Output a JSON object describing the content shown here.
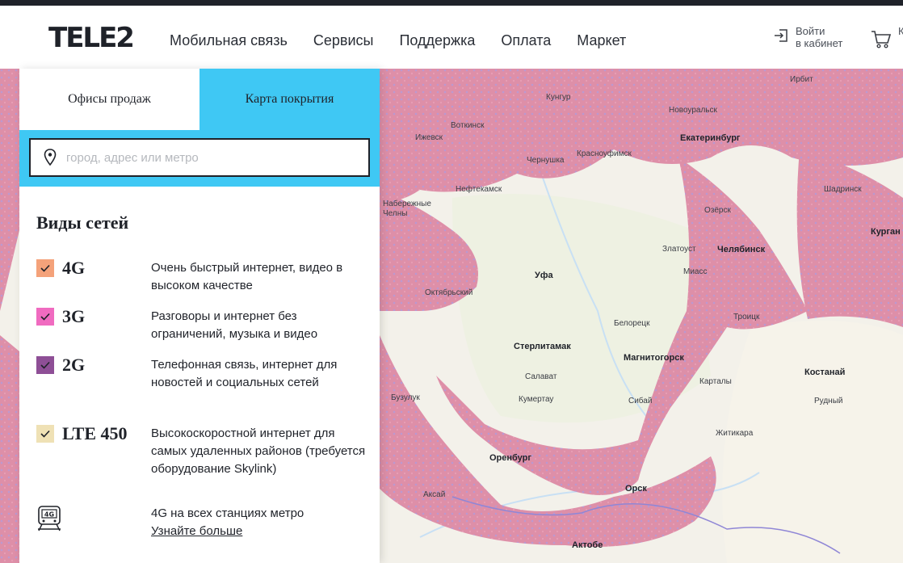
{
  "header": {
    "logo": "TELE2",
    "nav": [
      "Мобильная связь",
      "Сервисы",
      "Поддержка",
      "Оплата",
      "Маркет"
    ],
    "login": [
      "Войти",
      "в кабинет"
    ],
    "cart_label": "К"
  },
  "panel": {
    "tabs": [
      {
        "label": "Офисы продаж",
        "active": false
      },
      {
        "label": "Карта покрытия",
        "active": true
      }
    ],
    "search_placeholder": "город, адрес или метро",
    "section_title": "Виды сетей",
    "networks": [
      {
        "name": "4G",
        "color": "#f4a27a",
        "checked": true,
        "desc": "Очень быстрый интернет, видео в высоком качестве"
      },
      {
        "name": "3G",
        "color": "#f06bc0",
        "checked": true,
        "desc": "Разговоры и интернет без ограничений, музыка и видео"
      },
      {
        "name": "2G",
        "color": "#8e4f96",
        "checked": true,
        "desc": "Телефонная связь, интернет для новостей и социальных сетей"
      },
      {
        "name": "LTE 450",
        "color": "#efe1b5",
        "checked": true,
        "desc": "Высокоскоростной интернет для самых удаленных районов (требуется оборудование Skylink)"
      }
    ],
    "metro": {
      "icon_label": "4G",
      "text": "4G на всех станциях метро",
      "link": "Узнайте больше"
    }
  },
  "map": {
    "cities": [
      {
        "name": "Ирбит",
        "major": false
      },
      {
        "name": "Кунгур",
        "major": false
      },
      {
        "name": "Новоуральск",
        "major": false
      },
      {
        "name": "Воткинск",
        "major": false
      },
      {
        "name": "Ижевск",
        "major": false
      },
      {
        "name": "Чернушка",
        "major": false
      },
      {
        "name": "Красноуфимск",
        "major": false
      },
      {
        "name": "Екатеринбург",
        "major": true
      },
      {
        "name": "Нефтекамск",
        "major": false
      },
      {
        "name": "Набережные Челны",
        "major": false
      },
      {
        "name": "Шадринск",
        "major": false
      },
      {
        "name": "Озёрск",
        "major": false
      },
      {
        "name": "Курган",
        "major": true
      },
      {
        "name": "Златоуст",
        "major": false
      },
      {
        "name": "Челябинск",
        "major": true
      },
      {
        "name": "Миасс",
        "major": false
      },
      {
        "name": "Уфа",
        "major": true
      },
      {
        "name": "Октябрьский",
        "major": false
      },
      {
        "name": "Белорецк",
        "major": false
      },
      {
        "name": "Троицк",
        "major": false
      },
      {
        "name": "Стерлитамак",
        "major": true
      },
      {
        "name": "Магнитогорск",
        "major": true
      },
      {
        "name": "Салават",
        "major": false
      },
      {
        "name": "Костанай",
        "major": true
      },
      {
        "name": "Карталы",
        "major": false
      },
      {
        "name": "Кумертау",
        "major": false
      },
      {
        "name": "Сибай",
        "major": false
      },
      {
        "name": "Рудный",
        "major": false
      },
      {
        "name": "Бузулук",
        "major": false
      },
      {
        "name": "Житикара",
        "major": false
      },
      {
        "name": "Оренбург",
        "major": true
      },
      {
        "name": "Аксай",
        "major": false
      },
      {
        "name": "Орск",
        "major": true
      },
      {
        "name": "Актобе",
        "major": true
      }
    ]
  }
}
